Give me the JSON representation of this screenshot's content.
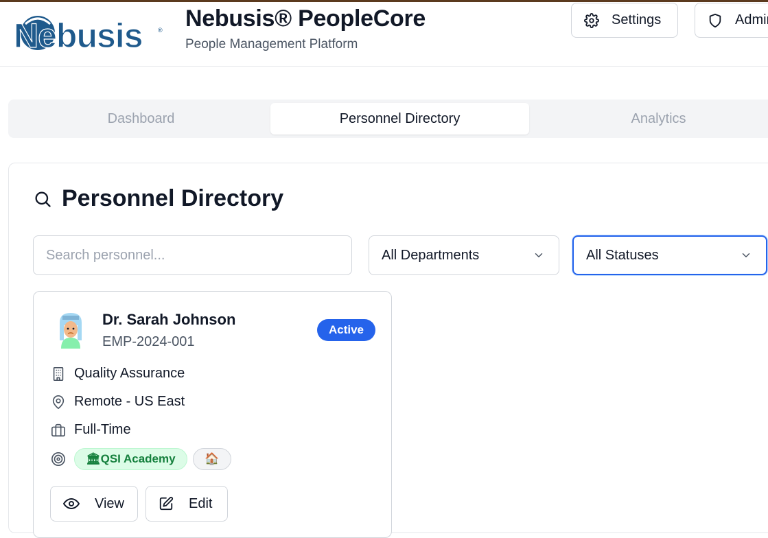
{
  "header": {
    "logo_text": "Nebusis",
    "title": "Nebusis® PeopleCore",
    "subtitle": "People Management Platform",
    "buttons": {
      "settings": "Settings",
      "admin": "Admin"
    }
  },
  "tabs": [
    {
      "label": "Dashboard",
      "active": false
    },
    {
      "label": "Personnel Directory",
      "active": true
    },
    {
      "label": "Analytics",
      "active": false
    }
  ],
  "directory": {
    "title": "Personnel Directory",
    "search_placeholder": "Search personnel...",
    "department_filter": "All Departments",
    "status_filter": "All Statuses"
  },
  "employees": [
    {
      "name": "Dr. Sarah Johnson",
      "id": "EMP-2024-001",
      "status": "Active",
      "department": "Quality Assurance",
      "location": "Remote - US East",
      "employment_type": "Full-Time",
      "tags": {
        "academy_icon": "🏛",
        "academy": "QSI Academy",
        "home_icon": "🏠"
      },
      "actions": {
        "view": "View",
        "edit": "Edit"
      }
    }
  ],
  "colors": {
    "primary": "#2563eb",
    "brand_blue": "#1f5a8c",
    "academy_green": "#15803d",
    "border": "#d1d5db"
  },
  "icons": [
    "settings-gear-icon",
    "shield-icon",
    "search-icon",
    "chevron-down-icon",
    "building-icon",
    "map-pin-icon",
    "briefcase-icon",
    "target-icon",
    "eye-icon",
    "edit-icon"
  ]
}
